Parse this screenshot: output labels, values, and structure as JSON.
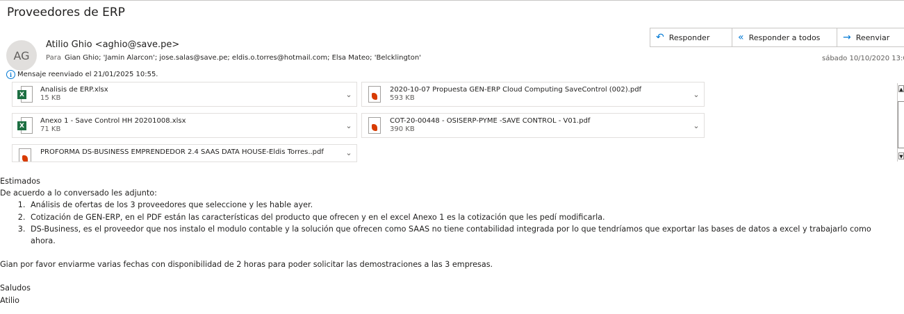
{
  "subject": "Proveedores de ERP",
  "sender": {
    "initials": "AG",
    "display": "Atilio Ghio <aghio@save.pe>"
  },
  "to_label": "Para",
  "recipients": "Gian Ghio; 'Jamin Alarcon'; jose.salas@save.pe; eldis.o.torres@hotmail.com; Elsa Mateo; 'Belcklington'",
  "date": "sábado 10/10/2020 13:0",
  "actions": {
    "reply": "Responder",
    "reply_all": "Responder a todos",
    "forward": "Reenviar",
    "more": "···"
  },
  "forward_info": "Mensaje reenviado el 21/01/2025 10:55.",
  "attachments": [
    {
      "name": "Analisis de ERP.xlsx",
      "size": "15 KB",
      "type": "excel"
    },
    {
      "name": "2020-10-07 Propuesta GEN-ERP Cloud Computing SaveControl (002).pdf",
      "size": "593 KB",
      "type": "pdf"
    },
    {
      "name": "Anexo 1 - Save Control HH 20201008.xlsx",
      "size": "71 KB",
      "type": "excel"
    },
    {
      "name": "COT-20-00448 - OSISERP-PYME -SAVE CONTROL - V01.pdf",
      "size": "390 KB",
      "type": "pdf"
    },
    {
      "name": "PROFORMA DS-BUSINESS  EMPRENDEDOR 2.4 SAAS DATA HOUSE-Eldis Torres..pdf",
      "size": "",
      "type": "pdf"
    }
  ],
  "body": {
    "greeting": "Estimados",
    "intro": "De acuerdo a lo conversado les adjunto:",
    "items": [
      "Análisis de ofertas de los 3 proveedores que seleccione y les hable ayer.",
      "Cotización de GEN-ERP, en el PDF están las características del producto que ofrecen y en el excel Anexo 1 es la cotización que les pedí modificarla.",
      "DS-Business, es el proveedor que nos instalo el modulo contable y la solución que ofrecen como SAAS no tiene contabilidad integrada por lo que tendríamos que exportar las bases de datos a excel y trabajarlo como",
      "ahora."
    ],
    "request": "Gian por favor enviarme varias fechas con disponibilidad de 2 horas para poder solicitar las demostraciones a las 3 empresas.",
    "closing": "Saludos",
    "signature": "Atilio"
  },
  "colors": {
    "accent": "#0078d4",
    "excel": "#1d6f42",
    "pdf": "#d83b01"
  }
}
